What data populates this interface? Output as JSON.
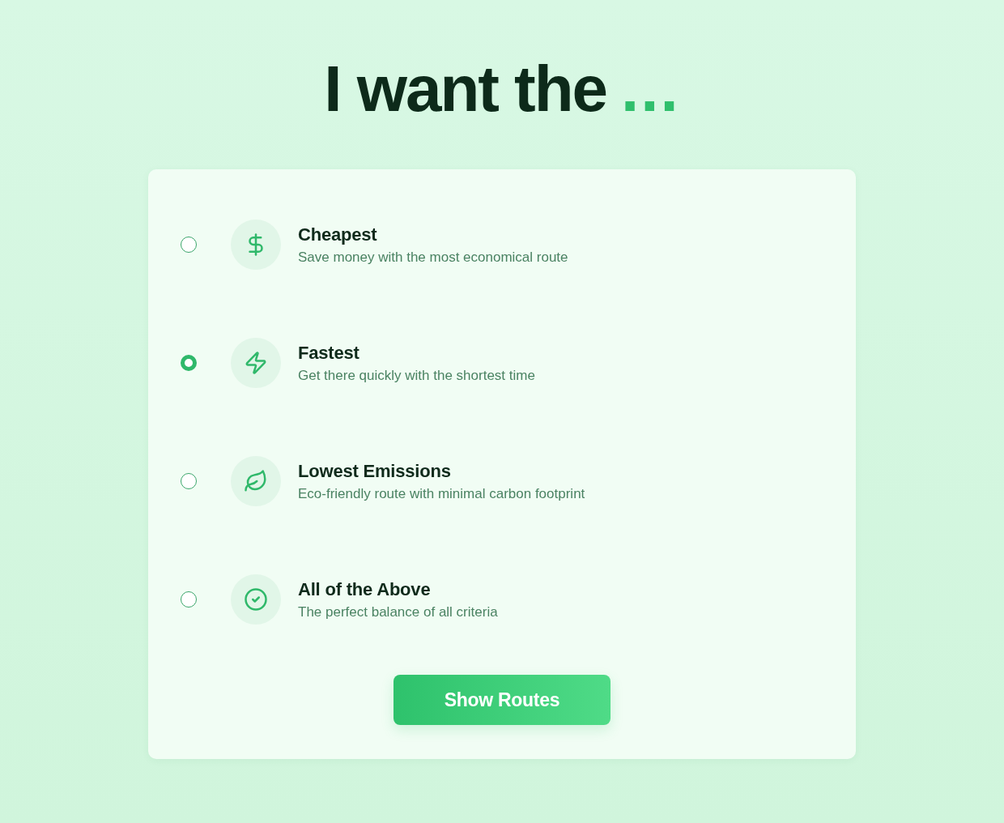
{
  "heading": {
    "text": "I want the",
    "ellipsis": "..."
  },
  "options": [
    {
      "kind": "dollar",
      "title": "Cheapest",
      "description": "Save money with the most economical route",
      "selected": false
    },
    {
      "kind": "bolt",
      "title": "Fastest",
      "description": "Get there quickly with the shortest time",
      "selected": true
    },
    {
      "kind": "leaf",
      "title": "Lowest Emissions",
      "description": "Eco-friendly route with minimal carbon footprint",
      "selected": false
    },
    {
      "kind": "check",
      "title": "All of the Above",
      "description": "The perfect balance of all criteria",
      "selected": false
    }
  ],
  "button": {
    "label": "Show Routes"
  }
}
